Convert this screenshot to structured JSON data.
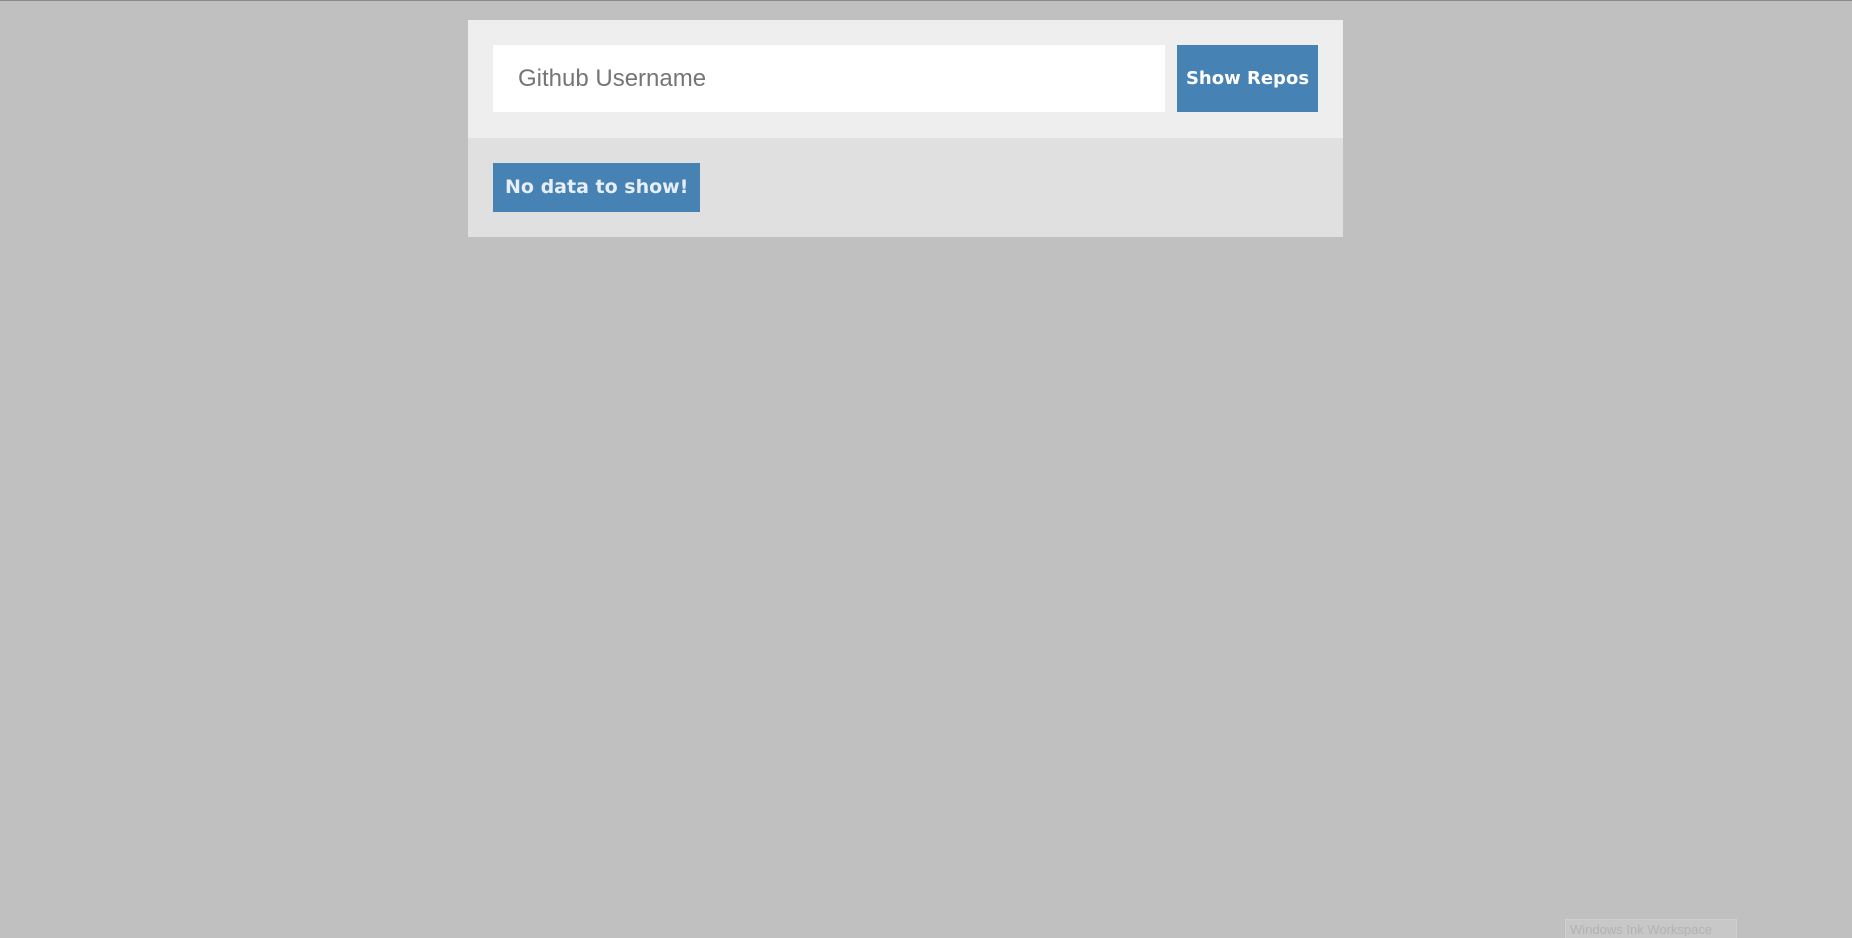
{
  "search": {
    "placeholder": "Github Username",
    "value": "",
    "button_label": "Show Repos"
  },
  "results": {
    "empty_message": "No data to show!"
  },
  "overlay": {
    "hint_text": "Windows Ink Workspace"
  },
  "colors": {
    "page_background": "#c0c0c0",
    "accent": "#4682b4",
    "search_panel": "#eeeeee",
    "results_panel": "#e0e0e0"
  }
}
